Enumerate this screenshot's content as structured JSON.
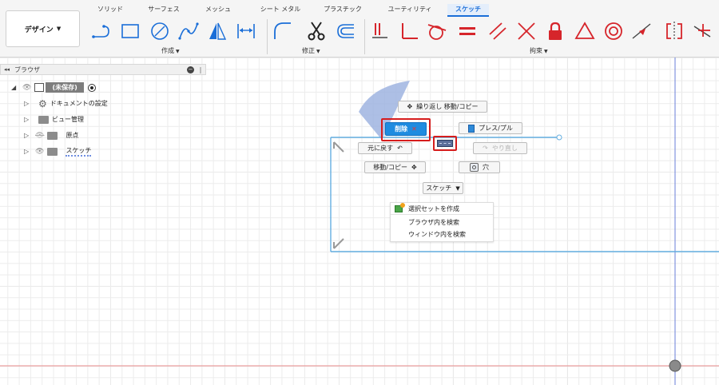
{
  "workspace": {
    "label": "デザイン"
  },
  "tabs": [
    {
      "label": "ソリッド",
      "active": false
    },
    {
      "label": "サーフェス",
      "active": false
    },
    {
      "label": "メッシュ",
      "active": false
    },
    {
      "label": "シート メタル",
      "active": false
    },
    {
      "label": "プラスチック",
      "active": false
    },
    {
      "label": "ユーティリティ",
      "active": false
    },
    {
      "label": "スケッチ",
      "active": true
    }
  ],
  "groups": {
    "create": "作成",
    "modify": "修正",
    "constraints": "拘束"
  },
  "tool_icons": {
    "create": [
      "line-icon",
      "rectangle-icon",
      "circle-icon",
      "spline-icon",
      "mirror-triangle-icon",
      "dimension-icon"
    ],
    "modify": [
      "fillet-icon",
      "scissors-icon",
      "offset-icon"
    ],
    "constraints": [
      "fix-icon",
      "perpendicular-icon",
      "tangent-icon",
      "equal-icon",
      "parallel-icon",
      "coincident-icon",
      "lock-icon",
      "triangle-icon",
      "concentric-icon",
      "midpoint-icon",
      "symmetry-icon",
      "horizontal-vertical-icon"
    ]
  },
  "browser": {
    "title": "ブラウザ",
    "root": "(未保存)",
    "items": [
      {
        "label": "ドキュメントの設定",
        "icon": "gear-icon"
      },
      {
        "label": "ビュー管理",
        "icon": "folder-icon"
      },
      {
        "label": "原点",
        "icon": "folder-icon"
      },
      {
        "label": "スケッチ",
        "icon": "folder-icon"
      }
    ]
  },
  "marking_menu": {
    "repeat": "繰り返し 移動/コピー",
    "delete": "削除",
    "press_pull": "プレス/プル",
    "undo": "元に戻す",
    "redo": "やり直し",
    "move_copy": "移動/コピー",
    "hole": "穴",
    "sketch": "スケッチ"
  },
  "submenu": {
    "items": [
      "選択セットを作成",
      "ブラウザ内を検索",
      "ウィンドウ内を検索"
    ]
  },
  "colors": {
    "accent": "#1a6ed8",
    "delete_bg": "#1f8ce0",
    "highlight": "#d61d1d",
    "constraint_red": "#d6252b",
    "sketch_line": "#64aee0"
  }
}
